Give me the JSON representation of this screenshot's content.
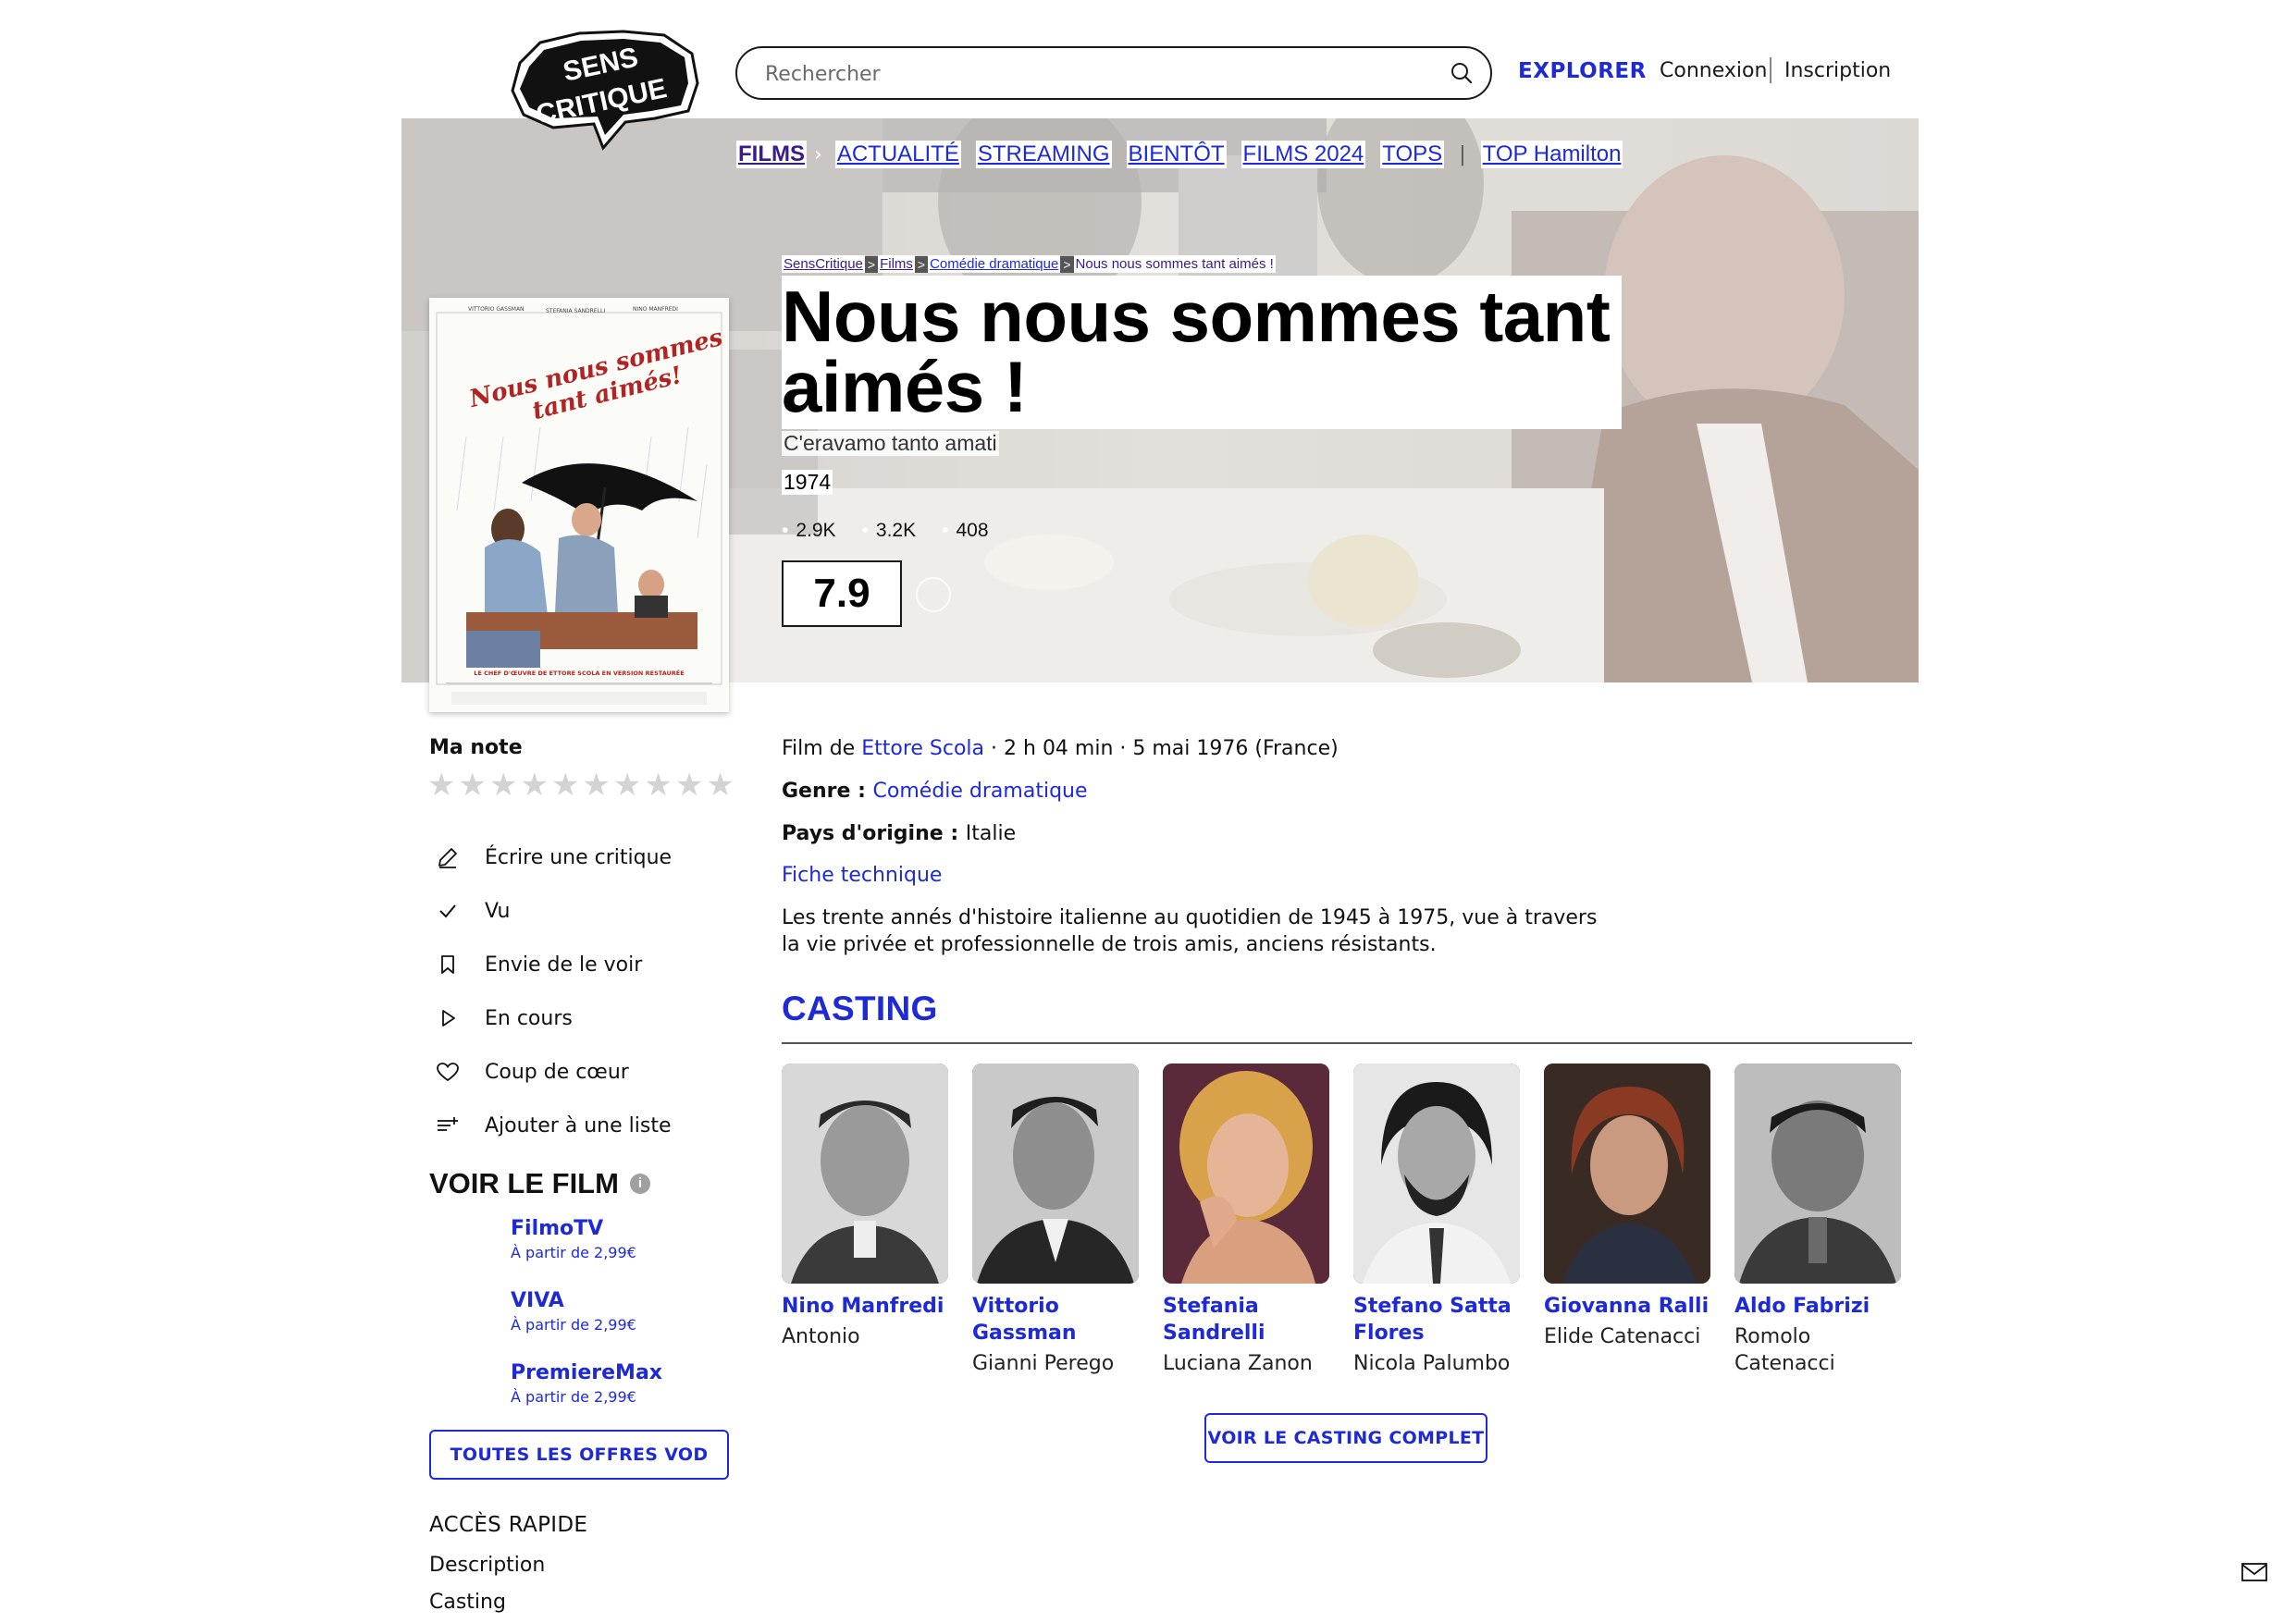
{
  "header": {
    "logo_text": "SENS CRITIQUE",
    "search_placeholder": "Rechercher",
    "explorer": "EXPLORER",
    "login": "Connexion",
    "signup": "Inscription"
  },
  "subnav": {
    "items": [
      "FILMS",
      "ACTUALITÉ",
      "STREAMING",
      "BIENTÔT",
      "FILMS 2024",
      "TOPS",
      "TOP Hamilton"
    ]
  },
  "breadcrumb": [
    "SensCritique",
    "Films",
    "Comédie dramatique",
    "Nous nous sommes tant aimés !"
  ],
  "film": {
    "title": "Nous nous sommes tant aimés !",
    "original_title": "C'eravamo tanto amati",
    "year": "1974",
    "stats": [
      "2.9K",
      "3.2K",
      "408"
    ],
    "rating": "7.9",
    "poster_credits": [
      "VITTORIO GASSMAN",
      "STEFANIA SANDRELLI",
      "NINO MANFREDI"
    ],
    "poster_title": "Nous nous sommes tant aimés!",
    "poster_tagline": "LE CHEF D'ŒUVRE DE ETTORE SCOLA EN VERSION RESTAURÉE"
  },
  "user": {
    "my_rating_label": "Ma note",
    "actions": [
      "Écrire une critique",
      "Vu",
      "Envie de le voir",
      "En cours",
      "Coup de cœur",
      "Ajouter à une liste"
    ]
  },
  "watch": {
    "title": "VOIR LE FILM",
    "offers": [
      {
        "name": "FilmoTV",
        "price": "À partir de 2,99€"
      },
      {
        "name": "VIVA",
        "price": "À partir de 2,99€"
      },
      {
        "name": "PremiereMax",
        "price": "À partir de 2,99€"
      }
    ],
    "all_offers_button": "TOUTES LES OFFRES VOD"
  },
  "quick_access": {
    "title": "ACCÈS RAPIDE",
    "links": [
      "Description",
      "Casting"
    ]
  },
  "details": {
    "film_by_prefix": "Film de ",
    "director": "Ettore Scola",
    "meta_suffix": " · 2 h 04 min · 5 mai 1976 (France)",
    "genre_label": "Genre : ",
    "genre": "Comédie dramatique",
    "country_label": "Pays d'origine : ",
    "country": "Italie",
    "tech_sheet": "Fiche technique",
    "synopsis": "Les trente annés d'histoire italienne au quotidien de 1945 à 1975, vue à travers la vie privée et professionnelle de trois amis, anciens résistants."
  },
  "casting": {
    "title": "CASTING",
    "members": [
      {
        "name": "Nino Manfredi",
        "role": "Antonio"
      },
      {
        "name": "Vittorio Gassman",
        "role": "Gianni Perego"
      },
      {
        "name": "Stefania Sandrelli",
        "role": "Luciana Zanon"
      },
      {
        "name": "Stefano Satta Flores",
        "role": "Nicola Palumbo"
      },
      {
        "name": "Giovanna Ralli",
        "role": "Elide Catenacci"
      },
      {
        "name": "Aldo Fabrizi",
        "role": "Romolo Catenacci"
      }
    ],
    "full_button": "VOIR LE CASTING COMPLET"
  }
}
